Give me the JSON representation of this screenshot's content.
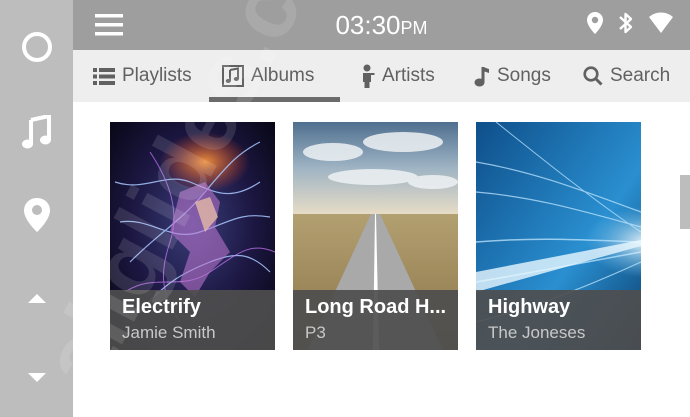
{
  "status": {
    "time": "03:30",
    "ampm": "PM",
    "icons": [
      "location-icon",
      "bluetooth-icon",
      "wifi-icon"
    ]
  },
  "rail": {
    "items": [
      "home-circle-icon",
      "music-note-icon",
      "location-pin-icon",
      "chevron-up-icon",
      "chevron-down-icon"
    ]
  },
  "tabs": [
    {
      "label": "Playlists",
      "icon": "list-icon"
    },
    {
      "label": "Albums",
      "icon": "album-icon",
      "active": true
    },
    {
      "label": "Artists",
      "icon": "artist-icon"
    },
    {
      "label": "Songs",
      "icon": "music-note-icon"
    },
    {
      "label": "Search",
      "icon": "search-icon"
    }
  ],
  "albums": [
    {
      "title": "Electrify",
      "artist": "Jamie Smith"
    },
    {
      "title": "Long Road H...",
      "artist": "P3"
    },
    {
      "title": "Highway",
      "artist": "The Joneses"
    }
  ],
  "watermark": "allglides.com",
  "colors": {
    "rail": "#bdbdbd",
    "statusbar": "#9e9e9e",
    "tabbar": "#eeeeee",
    "caption": "#4e4e4e",
    "active_tab_underline": "#6b6b6b"
  }
}
